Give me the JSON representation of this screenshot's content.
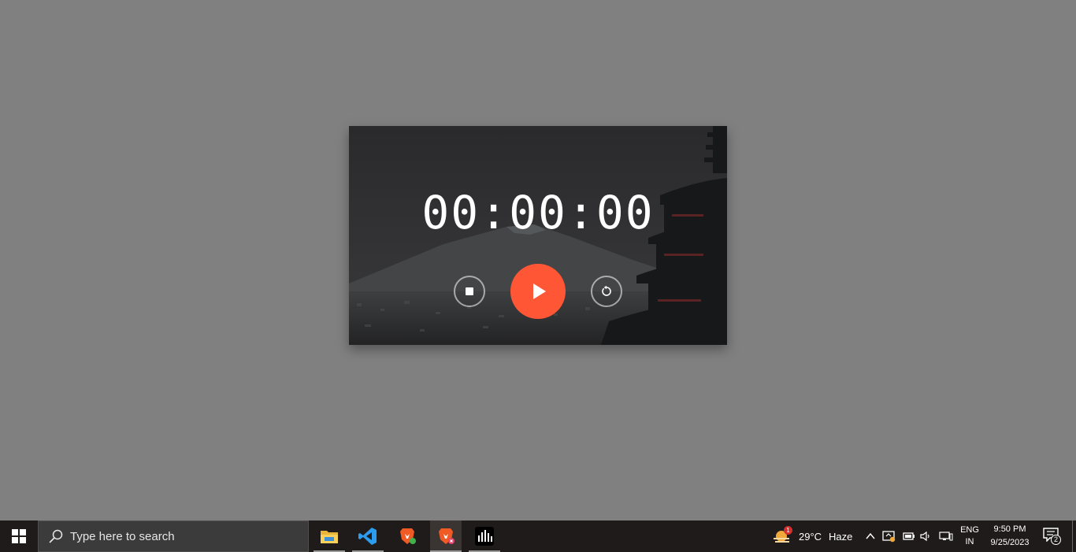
{
  "stopwatch": {
    "time": "00:00:00",
    "controls": {
      "stop_icon": "stop-icon",
      "play_icon": "play-icon",
      "reset_icon": "reset-icon"
    },
    "colors": {
      "accent": "#ff5636",
      "card_background": "#2b2b2d"
    }
  },
  "taskbar": {
    "search_placeholder": "Type here to search",
    "apps": [
      "file-explorer",
      "visual-studio-code",
      "brave-browser",
      "brave-browser-alt",
      "audio-app"
    ],
    "weather": {
      "badge": "1",
      "temperature": "29°C",
      "condition": "Haze"
    },
    "language": {
      "line1": "ENG",
      "line2": "IN"
    },
    "clock": {
      "time": "9:50 PM",
      "date": "9/25/2023"
    },
    "notifications_count": "2"
  }
}
